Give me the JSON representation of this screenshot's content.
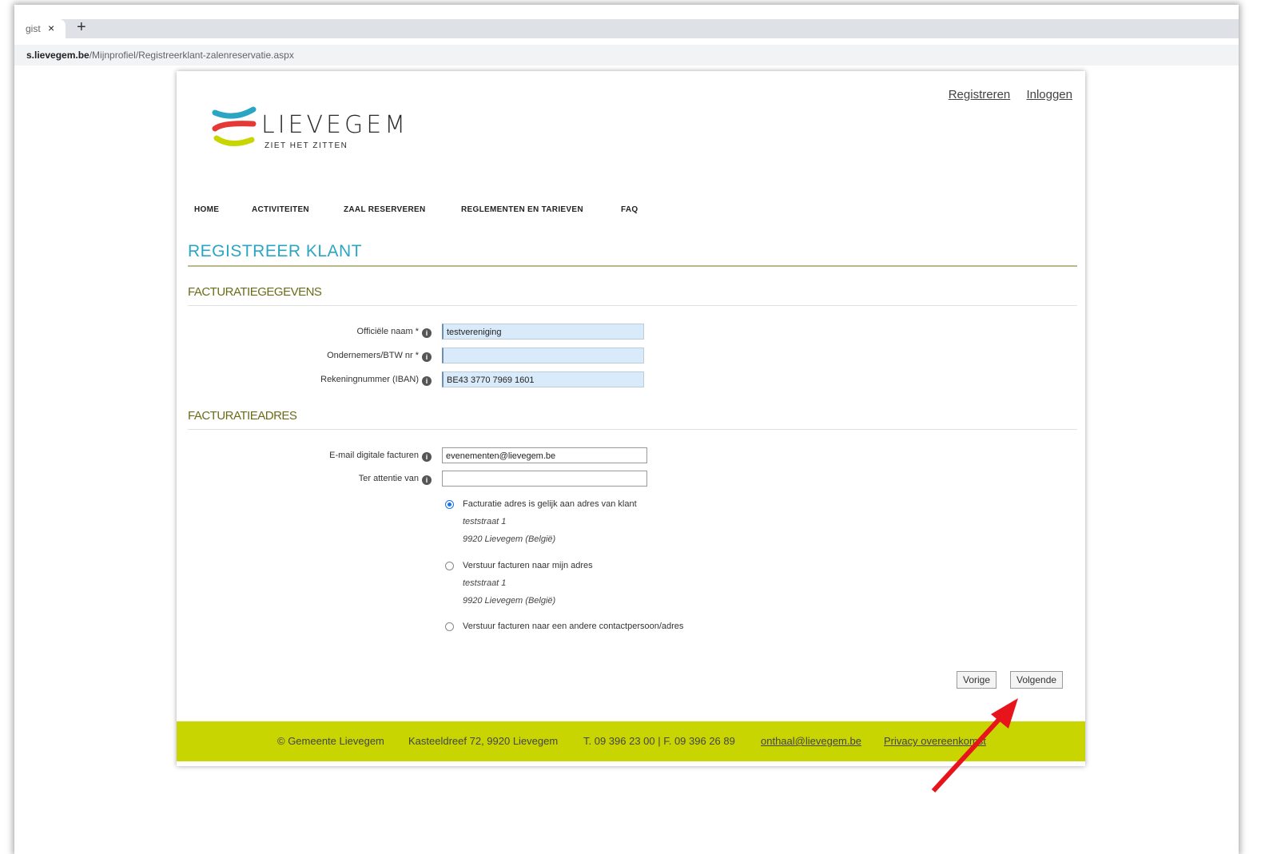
{
  "browser": {
    "tab_title": "gist",
    "tab_close": "×",
    "new_tab": "+",
    "url_host": "s.lievegem.be",
    "url_path": "/Mijnprofiel/Registreerklant-zalenreservatie.aspx"
  },
  "header": {
    "links": [
      "Registreren",
      "Inloggen"
    ],
    "logo_word": "LIEVEGEM",
    "logo_tagline": "ZIET HET ZITTEN"
  },
  "nav": {
    "items": [
      "HOME",
      "ACTIVITEITEN",
      "ZAAL RESERVEREN",
      "REGLEMENTEN EN TARIEVEN",
      "FAQ"
    ]
  },
  "page_title": "REGISTREER KLANT",
  "section_billing": {
    "title": "FACTURATIEGEGEVENS",
    "fields": [
      {
        "label": "Officiële naam *",
        "value": ""
      },
      {
        "label": "Ondernemers/BTW nr *",
        "value": ""
      },
      {
        "label": "Rekeningnummer (IBAN)",
        "value": "BE43 3770 7969 1601"
      }
    ],
    "official_name_value": "testvereniging"
  },
  "section_address": {
    "title": "FACTURATIEADRES",
    "email_label": "E-mail digitale facturen",
    "email_value": "evenementen@lievegem.be",
    "attention_label": "Ter attentie van",
    "attention_value": "",
    "options": [
      {
        "label": "Facturatie adres is gelijk aan adres van klant",
        "street": "teststraat 1",
        "city": "9920 Lievegem (België)",
        "selected": true
      },
      {
        "label": "Verstuur facturen naar mijn adres",
        "street": "teststraat 1",
        "city": "9920 Lievegem (België)",
        "selected": false
      },
      {
        "label": "Verstuur facturen naar een andere contactpersoon/adres",
        "selected": false
      }
    ]
  },
  "buttons": {
    "previous": "Vorige",
    "next": "Volgende"
  },
  "footer": {
    "copyright": "© Gemeente Lievegem",
    "address": "Kasteeldreef 72, 9920 Lievegem",
    "phone": "T. 09 396 23 00 | F. 09 396 26 89",
    "email": "onthaal@lievegem.be",
    "privacy": "Privacy overeenkomst"
  },
  "colors": {
    "title_blue": "#2aa6c4",
    "section_olive": "#6b6b1a",
    "footer_green": "#c9d500",
    "arrow_red": "#e8141c",
    "logo_blue": "#2aa6c4",
    "logo_red": "#e53935",
    "logo_yellow": "#c9d500"
  },
  "annotation": "red-arrow-icon"
}
